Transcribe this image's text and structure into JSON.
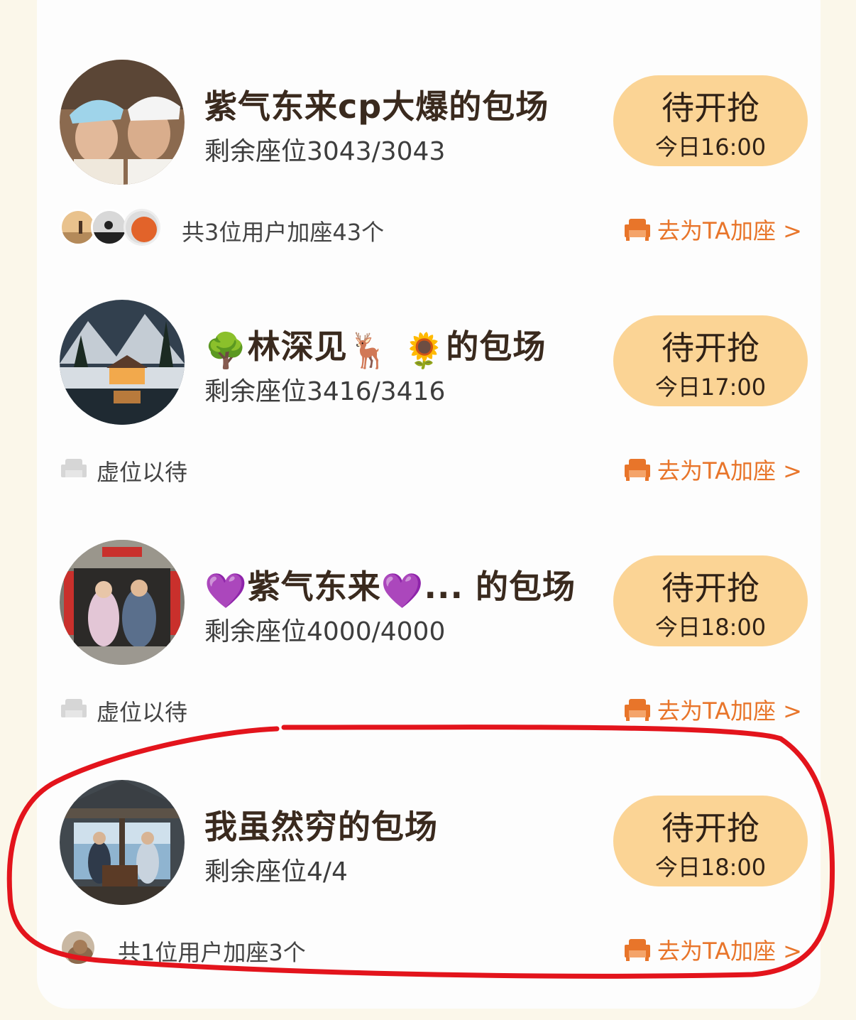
{
  "colors": {
    "accent": "#e8752a",
    "button_bg": "#fbd495",
    "title_text": "#3a2a1e",
    "annotation": "#e3141c"
  },
  "sessions": [
    {
      "title": "紫气东来cp大爆的包场",
      "seats": "剩余座位3043/3043",
      "button_label": "待开抢",
      "button_time": "今日16:00",
      "meta_text": "共3位用户加座43个",
      "add_seat": "去为TA加座 >"
    },
    {
      "title_pre": "🌳",
      "title_main": "林深见",
      "title_emoji_a": "🦌",
      "title_emoji_b": "🌻",
      "title_post": "的包场",
      "seats": "剩余座位3416/3416",
      "button_label": "待开抢",
      "button_time": "今日17:00",
      "meta_text": "虚位以待",
      "add_seat": "去为TA加座 >"
    },
    {
      "title_pre": "💜",
      "title_main": "紫气东来",
      "title_emoji": "💜",
      "title_post": "... 的包场",
      "seats": "剩余座位4000/4000",
      "button_label": "待开抢",
      "button_time": "今日18:00",
      "meta_text": "虚位以待",
      "add_seat": "去为TA加座 >"
    },
    {
      "title": "我虽然穷的包场",
      "seats": "剩余座位4/4",
      "button_label": "待开抢",
      "button_time": "今日18:00",
      "meta_text": "共1位用户加座3个",
      "add_seat": "去为TA加座 >"
    }
  ]
}
